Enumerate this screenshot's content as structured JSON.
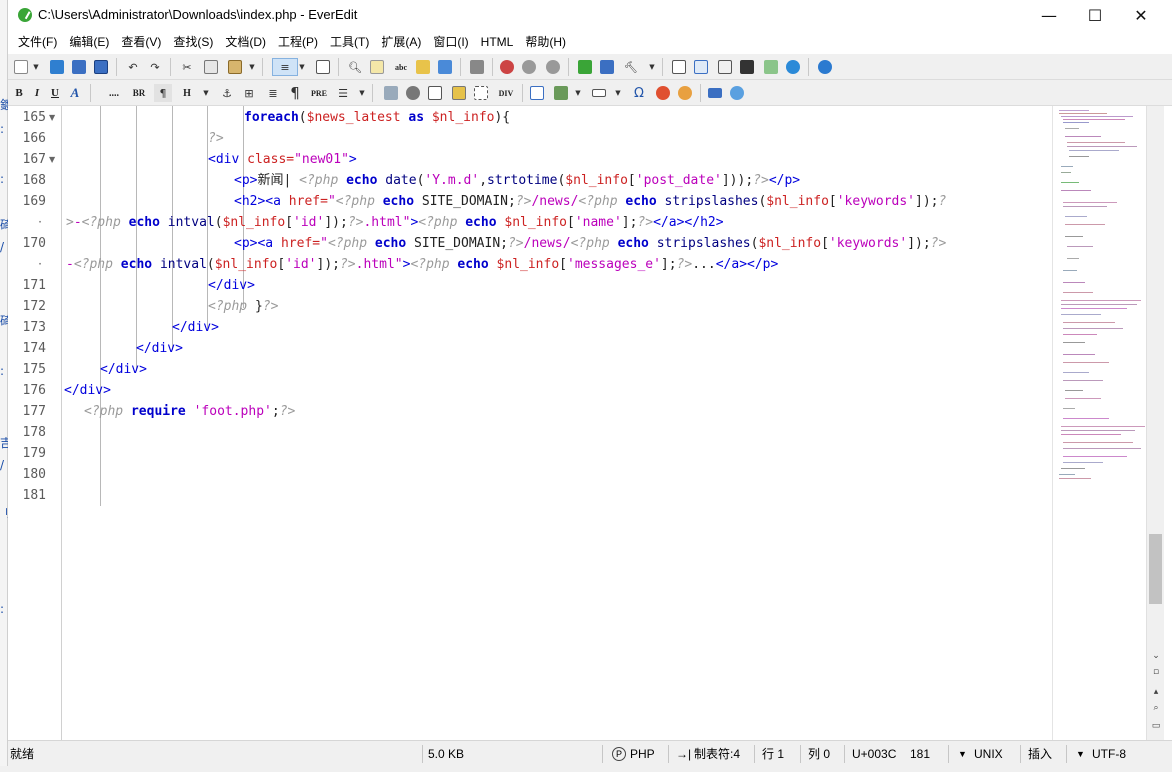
{
  "window": {
    "title": "C:\\Users\\Administrator\\Downloads\\index.php - EverEdit",
    "minimize": "—",
    "maximize": "☐",
    "close": "✕"
  },
  "menu": [
    "文件(F)",
    "编辑(E)",
    "查看(V)",
    "查找(S)",
    "文档(D)",
    "工程(P)",
    "工具(T)",
    "扩展(A)",
    "窗口(I)",
    "HTML",
    "帮助(H)"
  ],
  "toolbar2_labels": {
    "bold": "B",
    "italic": "I",
    "underline": "U",
    "anchor_font": "A",
    "br": "BR",
    "h": "H",
    "pre": "PRE",
    "div": "DIV",
    "omega": "Ω"
  },
  "line_numbers": [
    "165",
    "166",
    "167",
    "168",
    "169",
    "·",
    "170",
    "·",
    "171",
    "172",
    "173",
    "174",
    "175",
    "176",
    "177",
    "178",
    "179",
    "180",
    "181"
  ],
  "status": {
    "ready": "就绪",
    "size": "5.0 KB",
    "lang_icon": "P",
    "lang": "PHP",
    "tab_icon": "→|",
    "tab": "制表符:4",
    "row": "行 1",
    "col": "列 0",
    "unicode": "U+003C",
    "count": "181",
    "eol": "UNIX",
    "mode": "插入",
    "encoding": "UTF-8"
  },
  "colors": {
    "keyword": "#0000cc",
    "tag": "#0000dd",
    "attribute": "#cc2222",
    "string": "#bb00bb",
    "php_delimiter": "#9a9a9a"
  }
}
